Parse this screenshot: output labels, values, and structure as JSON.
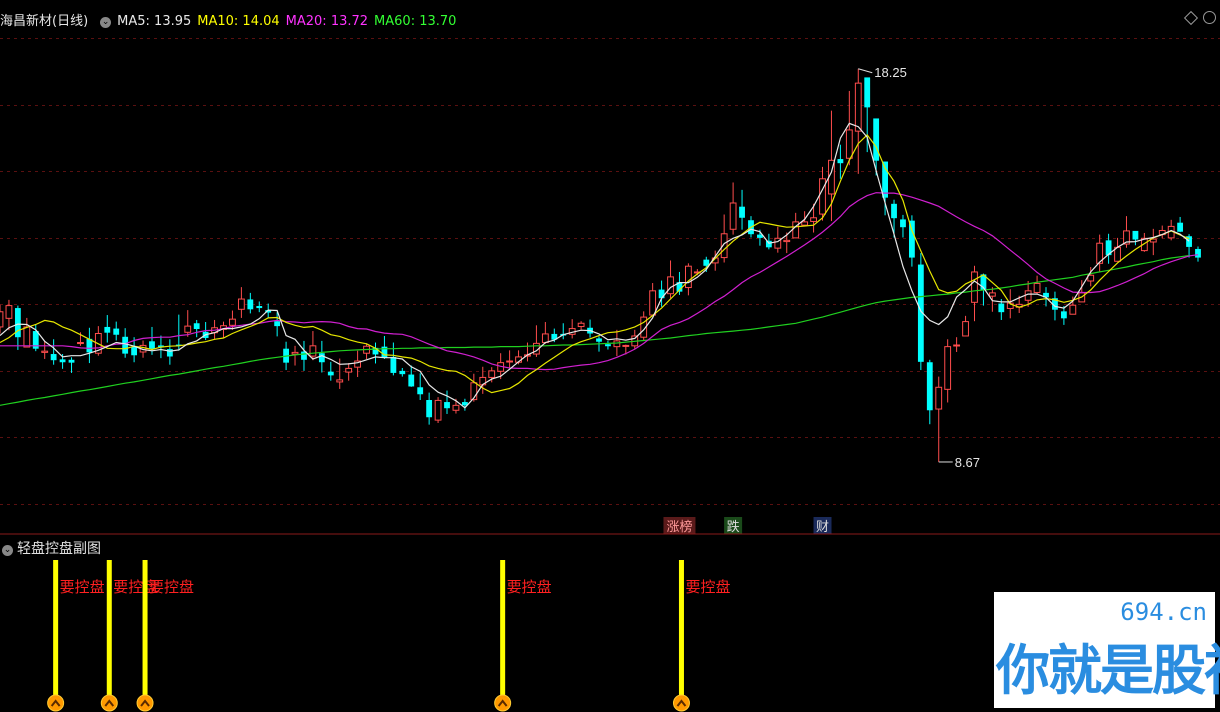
{
  "header": {
    "stock_title": "海昌新材(日线)",
    "ma_labels": [
      {
        "text": "MA5: 13.95",
        "color": "#e8e8e8"
      },
      {
        "text": "MA10: 14.04",
        "color": "#ffff00"
      },
      {
        "text": "MA20: 13.72",
        "color": "#ff33ff"
      },
      {
        "text": "MA60: 13.70",
        "color": "#33ff33"
      }
    ]
  },
  "colors": {
    "up": "#ff4d4d",
    "down": "#00ffff",
    "ma5": "#e8e8e8",
    "ma10": "#e6e600",
    "ma20": "#d020d0",
    "ma60": "#20d020",
    "grid": "#5a1010",
    "signal": "#ffff00"
  },
  "chart_data": {
    "type": "candlestick",
    "ylim": [
      7.5,
      19.0
    ],
    "high_annotation": "18.25",
    "low_annotation": "8.67",
    "high_value": 18.25,
    "low_value": 8.67,
    "candles": [
      [
        11.96,
        12.33,
        12.5,
        11.8
      ],
      [
        12.17,
        12.48,
        12.62,
        11.88
      ],
      [
        12.42,
        11.71,
        12.48,
        11.4
      ],
      [
        11.47,
        11.96,
        12.18,
        11.46
      ],
      [
        11.86,
        11.43,
        12.03,
        11.37
      ],
      [
        11.34,
        11.37,
        11.61,
        11.18
      ],
      [
        11.3,
        11.15,
        11.66,
        11.04
      ],
      [
        11.17,
        11.1,
        11.3,
        10.94
      ],
      [
        11.16,
        11.09,
        11.22,
        10.84
      ],
      [
        11.57,
        11.58,
        11.83,
        11.5
      ],
      [
        11.67,
        11.34,
        11.94,
        11.08
      ],
      [
        11.32,
        11.8,
        11.98,
        11.26
      ],
      [
        11.96,
        11.82,
        12.25,
        11.58
      ],
      [
        11.92,
        11.77,
        12.09,
        11.63
      ],
      [
        11.72,
        11.31,
        11.93,
        11.21
      ],
      [
        11.48,
        11.27,
        11.71,
        11.1
      ],
      [
        11.35,
        11.51,
        11.63,
        11.21
      ],
      [
        11.61,
        11.43,
        11.96,
        11.28
      ],
      [
        11.51,
        11.47,
        11.75,
        11.2
      ],
      [
        11.42,
        11.24,
        11.66,
        11.04
      ],
      [
        11.53,
        11.5,
        12.26,
        11.38
      ],
      [
        11.83,
        11.98,
        12.37,
        11.72
      ],
      [
        12.05,
        11.91,
        12.13,
        11.71
      ],
      [
        11.84,
        11.69,
        12.08,
        11.64
      ],
      [
        11.82,
        11.94,
        12.13,
        11.66
      ],
      [
        11.9,
        11.99,
        12.09,
        11.7
      ],
      [
        12.0,
        12.15,
        12.36,
        11.89
      ],
      [
        12.39,
        12.64,
        12.93,
        12.18
      ],
      [
        12.63,
        12.39,
        12.79,
        12.29
      ],
      [
        12.47,
        12.42,
        12.58,
        12.32
      ],
      [
        12.37,
        12.31,
        12.53,
        12.18
      ],
      [
        12.1,
        11.98,
        12.32,
        11.73
      ],
      [
        11.43,
        11.09,
        11.6,
        10.91
      ],
      [
        11.3,
        11.34,
        11.5,
        11.02
      ],
      [
        11.36,
        11.16,
        11.62,
        10.89
      ],
      [
        11.25,
        11.5,
        11.86,
        11.15
      ],
      [
        11.32,
        11.1,
        11.62,
        10.85
      ],
      [
        10.87,
        10.78,
        11.11,
        10.65
      ],
      [
        10.62,
        10.67,
        11.19,
        10.45
      ],
      [
        10.86,
        10.95,
        11.08,
        10.65
      ],
      [
        10.98,
        11.13,
        11.38,
        10.74
      ],
      [
        11.32,
        11.49,
        11.56,
        11.18
      ],
      [
        11.45,
        11.29,
        11.58,
        11.07
      ],
      [
        11.48,
        11.21,
        11.74,
        11.18
      ],
      [
        11.23,
        10.84,
        11.58,
        10.78
      ],
      [
        10.89,
        10.81,
        10.96,
        10.75
      ],
      [
        10.8,
        10.51,
        11.02,
        10.5
      ],
      [
        10.49,
        10.32,
        10.83,
        10.18
      ],
      [
        10.18,
        9.76,
        10.36,
        9.58
      ],
      [
        9.69,
        10.17,
        10.25,
        9.62
      ],
      [
        10.13,
        9.98,
        10.41,
        9.84
      ],
      [
        9.93,
        10.05,
        10.21,
        9.85
      ],
      [
        10.13,
        10.05,
        10.21,
        9.92
      ],
      [
        10.19,
        10.6,
        10.82,
        10.14
      ],
      [
        10.55,
        10.73,
        10.99,
        10.33
      ],
      [
        10.73,
        10.89,
        10.98,
        10.61
      ],
      [
        10.88,
        11.09,
        11.32,
        10.69
      ],
      [
        11.11,
        11.13,
        11.39,
        10.95
      ],
      [
        11.1,
        11.23,
        11.39,
        11.05
      ],
      [
        11.25,
        11.28,
        11.58,
        11.12
      ],
      [
        11.3,
        11.56,
        12.0,
        11.23
      ],
      [
        11.58,
        11.79,
        12.08,
        11.55
      ],
      [
        11.79,
        11.65,
        11.92,
        11.59
      ],
      [
        11.79,
        11.75,
        12.05,
        11.66
      ],
      [
        11.78,
        11.92,
        12.15,
        11.68
      ],
      [
        11.97,
        12.05,
        12.1,
        11.9
      ],
      [
        11.94,
        11.8,
        12.14,
        11.7
      ],
      [
        11.68,
        11.6,
        11.73,
        11.36
      ],
      [
        11.54,
        11.49,
        11.62,
        11.41
      ],
      [
        11.48,
        11.62,
        11.89,
        11.25
      ],
      [
        11.51,
        11.51,
        11.53,
        11.29
      ],
      [
        11.5,
        11.74,
        11.89,
        11.42
      ],
      [
        11.71,
        12.2,
        12.34,
        11.63
      ],
      [
        12.25,
        12.84,
        13.03,
        12.22
      ],
      [
        12.87,
        12.66,
        13.09,
        12.45
      ],
      [
        12.77,
        13.18,
        13.58,
        12.66
      ],
      [
        13.05,
        12.82,
        13.3,
        12.74
      ],
      [
        12.92,
        13.44,
        13.51,
        12.73
      ],
      [
        13.28,
        13.3,
        13.37,
        13.22
      ],
      [
        13.6,
        13.45,
        13.67,
        13.3
      ],
      [
        13.52,
        13.64,
        13.82,
        13.33
      ],
      [
        13.65,
        14.23,
        14.7,
        13.53
      ],
      [
        14.34,
        14.98,
        15.48,
        14.21
      ],
      [
        14.89,
        14.62,
        15.3,
        14.33
      ],
      [
        14.56,
        14.22,
        14.66,
        14.14
      ],
      [
        14.21,
        14.13,
        14.33,
        13.94
      ],
      [
        14.06,
        13.9,
        14.23,
        13.85
      ],
      [
        13.88,
        14.12,
        14.4,
        13.77
      ],
      [
        14.04,
        14.07,
        14.26,
        13.76
      ],
      [
        14.13,
        14.52,
        14.74,
        14.14
      ],
      [
        14.44,
        14.52,
        14.78,
        14.45
      ],
      [
        14.53,
        14.62,
        14.96,
        14.26
      ],
      [
        14.71,
        15.57,
        15.86,
        14.55
      ],
      [
        15.2,
        16.02,
        17.23,
        14.54
      ],
      [
        16.05,
        15.95,
        16.4,
        15.57
      ],
      [
        16.07,
        16.76,
        17.71,
        15.9
      ],
      [
        16.73,
        17.9,
        18.25,
        15.69
      ],
      [
        18.04,
        17.31,
        17.64,
        16.22
      ],
      [
        17.04,
        16.01,
        16.94,
        15.65
      ],
      [
        15.99,
        15.11,
        15.36,
        14.68
      ],
      [
        14.96,
        14.61,
        15.06,
        14.14
      ],
      [
        14.58,
        14.39,
        14.69,
        14.14
      ],
      [
        14.55,
        13.65,
        14.68,
        13.43
      ],
      [
        13.48,
        11.11,
        13.76,
        10.91
      ],
      [
        11.1,
        9.93,
        11.16,
        9.59
      ],
      [
        9.96,
        10.49,
        10.75,
        8.67
      ],
      [
        10.44,
        11.48,
        11.66,
        10.12
      ],
      [
        11.51,
        11.52,
        11.71,
        11.35
      ],
      [
        11.74,
        12.09,
        12.23,
        11.86
      ],
      [
        12.56,
        13.3,
        13.45,
        12.1
      ],
      [
        13.24,
        12.85,
        13.26,
        12.48
      ],
      [
        12.71,
        12.79,
        12.93,
        12.33
      ],
      [
        12.53,
        12.32,
        12.64,
        12.13
      ],
      [
        12.41,
        12.54,
        12.88,
        12.17
      ],
      [
        12.44,
        12.51,
        12.72,
        12.3
      ],
      [
        12.61,
        12.84,
        13.08,
        12.45
      ],
      [
        12.8,
        13.02,
        13.21,
        12.76
      ],
      [
        12.79,
        12.68,
        12.93,
        12.46
      ],
      [
        12.66,
        12.38,
        12.82,
        12.12
      ],
      [
        12.34,
        12.17,
        12.47,
        12.01
      ],
      [
        12.27,
        12.49,
        12.7,
        12.28
      ],
      [
        12.57,
        12.79,
        13.1,
        12.58
      ],
      [
        13.08,
        13.22,
        13.42,
        12.95
      ],
      [
        13.51,
        14.0,
        14.21,
        13.31
      ],
      [
        14.07,
        13.71,
        14.23,
        13.5
      ],
      [
        13.56,
        13.9,
        14.13,
        13.55
      ],
      [
        13.98,
        14.3,
        14.66,
        13.89
      ],
      [
        14.3,
        14.09,
        14.29,
        13.95
      ],
      [
        13.82,
        14.12,
        14.25,
        13.79
      ],
      [
        14.03,
        14.1,
        14.35,
        13.71
      ],
      [
        14.21,
        14.31,
        14.43,
        14.12
      ],
      [
        14.13,
        14.41,
        14.57,
        14.07
      ],
      [
        14.5,
        14.28,
        14.64,
        14.27
      ],
      [
        14.17,
        13.91,
        14.22,
        13.65
      ],
      [
        13.86,
        13.65,
        13.92,
        13.55
      ]
    ],
    "ma5": [
      11.75,
      11.94,
      12.03,
      12.02,
      11.89,
      11.61,
      11.45,
      11.23,
      11.26,
      11.26,
      11.32,
      11.39,
      11.48,
      11.58,
      11.55,
      11.49,
      11.41,
      11.38,
      11.41,
      11.37,
      11.4,
      11.55,
      11.62,
      11.77,
      11.82,
      11.92,
      11.92,
      11.96,
      12.03,
      12.16,
      12.37,
      12.36,
      11.75,
      11.66,
      11.39,
      11.18,
      11.26,
      11.17,
      11.05,
      11.06,
      11.09,
      11.16,
      11.23,
      11.21,
      11.21,
      11.18,
      10.99,
      10.88,
      10.55,
      10.37,
      10.28,
      10.16,
      9.99,
      10.23,
      10.56,
      10.69,
      10.76,
      10.93,
      11.11,
      11.28,
      11.38,
      11.58,
      11.64,
      11.77,
      11.83,
      11.88,
      11.87,
      11.79,
      11.65,
      11.67,
      11.64,
      11.68,
      11.89,
      12.18,
      12.66,
      12.92,
      13.04,
      13.04,
      13.17,
      13.36,
      13.68,
      13.99,
      14.12,
      14.2,
      14.34,
      14.28,
      14.0,
      14.04,
      14.2,
      14.41,
      14.58,
      14.9,
      15.31,
      15.73,
      16.56,
      16.92,
      16.84,
      16.58,
      15.77,
      14.98,
      14.22,
      13.43,
      12.84,
      12.34,
      12.12,
      12.02,
      12.21,
      12.69,
      12.87,
      13.08,
      12.92,
      12.6,
      12.57,
      12.57,
      12.67,
      12.76,
      12.76,
      12.68,
      12.46,
      12.42,
      12.59,
      12.94,
      13.3,
      13.54,
      13.73,
      13.9,
      14.03,
      14.04,
      14.1,
      14.14,
      14.21,
      14.31,
      14.22,
      14.05
    ],
    "ma10": [
      11.58,
      11.7,
      11.87,
      11.95,
      12.02,
      12.12,
      12.08,
      11.96,
      11.88,
      11.77,
      11.66,
      11.55,
      11.44,
      11.43,
      11.43,
      11.49,
      11.46,
      11.41,
      11.47,
      11.49,
      11.5,
      11.53,
      11.57,
      11.6,
      11.66,
      11.69,
      11.8,
      11.89,
      11.97,
      12.06,
      12.18,
      12.19,
      12.07,
      12.0,
      11.95,
      11.97,
      11.88,
      11.77,
      11.73,
      11.65,
      11.59,
      11.55,
      11.44,
      11.28,
      11.27,
      11.23,
      11.2,
      11.12,
      11.01,
      10.95,
      10.9,
      10.88,
      10.78,
      10.62,
      10.47,
      10.36,
      10.41,
      10.46,
      10.59,
      10.78,
      10.92,
      11.08,
      11.22,
      11.37,
      11.51,
      11.6,
      11.67,
      11.75,
      11.82,
      11.84,
      11.89,
      11.96,
      12.07,
      12.24,
      12.42,
      12.64,
      12.86,
      13.08,
      13.25,
      13.4,
      13.63,
      13.85,
      14.05,
      14.22,
      14.39,
      14.51,
      14.47,
      14.43,
      14.39,
      14.4,
      14.42,
      14.44,
      14.62,
      14.96,
      15.51,
      16.02,
      16.43,
      16.64,
      16.35,
      15.83,
      15.51,
      15.04,
      14.31,
      13.81,
      13.32,
      12.87,
      12.79,
      12.83,
      13.01,
      13.11,
      13.23,
      13.04,
      12.85,
      12.52,
      12.44,
      12.51,
      12.62,
      12.65,
      12.62,
      12.56,
      12.61,
      12.69,
      12.86,
      13.1,
      13.31,
      13.52,
      13.69,
      13.85,
      13.99,
      14.13,
      14.21,
      14.3,
      14.2,
      14.11
    ],
    "ma20": [
      11.5,
      11.5,
      11.5,
      11.5,
      11.5,
      11.5,
      11.5,
      11.5,
      11.48,
      11.45,
      11.44,
      11.45,
      11.5,
      11.54,
      11.55,
      11.63,
      11.68,
      11.7,
      11.71,
      11.71,
      11.75,
      11.77,
      11.83,
      11.87,
      11.88,
      11.92,
      11.97,
      12.0,
      12.03,
      12.05,
      12.09,
      12.12,
      12.09,
      12.08,
      12.06,
      12.08,
      12.09,
      12.08,
      12.05,
      11.97,
      11.92,
      11.91,
      11.85,
      11.81,
      11.79,
      11.78,
      11.72,
      11.63,
      11.54,
      11.46,
      11.38,
      11.34,
      11.29,
      11.23,
      11.15,
      11.06,
      11.0,
      10.96,
      10.95,
      10.95,
      10.93,
      10.92,
      10.93,
      10.97,
      11.0,
      11.03,
      11.05,
      11.09,
      11.14,
      11.22,
      11.31,
      11.42,
      11.56,
      11.73,
      11.9,
      12.0,
      12.07,
      12.16,
      12.29,
      12.43,
      12.58,
      12.71,
      12.87,
      13.04,
      13.18,
      13.29,
      13.42,
      13.55,
      13.68,
      13.82,
      13.96,
      14.11,
      14.27,
      14.45,
      14.65,
      14.89,
      15.04,
      15.16,
      15.23,
      15.22,
      15.22,
      15.18,
      15.12,
      15.05,
      14.98,
      14.9,
      14.77,
      14.64,
      14.52,
      14.41,
      14.31,
      14.18,
      14.01,
      13.83,
      13.66,
      13.48,
      13.29,
      13.13,
      13.02,
      12.91,
      12.81,
      12.8,
      12.8,
      12.82,
      12.89,
      12.97,
      13.06,
      13.16,
      13.26,
      13.38,
      13.47,
      13.55,
      13.62,
      13.69,
      13.72
    ],
    "ma60": [
      10.05,
      10.09,
      10.13,
      10.17,
      10.21,
      10.24,
      10.28,
      10.32,
      10.36,
      10.4,
      10.43,
      10.47,
      10.51,
      10.55,
      10.59,
      10.62,
      10.66,
      10.7,
      10.74,
      10.78,
      10.81,
      10.85,
      10.89,
      10.93,
      10.97,
      11.0,
      11.04,
      11.08,
      11.12,
      11.16,
      11.19,
      11.22,
      11.25,
      11.28,
      11.3,
      11.32,
      11.34,
      11.36,
      11.38,
      11.39,
      11.4,
      11.41,
      11.42,
      11.43,
      11.43,
      11.44,
      11.44,
      11.45,
      11.45,
      11.45,
      11.46,
      11.46,
      11.46,
      11.47,
      11.47,
      11.47,
      11.48,
      11.48,
      11.48,
      11.49,
      11.5,
      11.5,
      11.51,
      11.52,
      11.52,
      11.53,
      11.54,
      11.55,
      11.56,
      11.57,
      11.59,
      11.61,
      11.63,
      11.65,
      11.67,
      11.69,
      11.72,
      11.75,
      11.77,
      11.8,
      11.82,
      11.84,
      11.86,
      11.88,
      11.9,
      11.93,
      11.96,
      11.99,
      12.02,
      12.05,
      12.1,
      12.15,
      12.2,
      12.26,
      12.32,
      12.38,
      12.44,
      12.5,
      12.55,
      12.59,
      12.62,
      12.65,
      12.68,
      12.7,
      12.72,
      12.74,
      12.76,
      12.79,
      12.81,
      12.84,
      12.86,
      12.88,
      12.91,
      12.94,
      12.98,
      13.01,
      13.05,
      13.08,
      13.11,
      13.14,
      13.17,
      13.22,
      13.26,
      13.3,
      13.34,
      13.38,
      13.42,
      13.47,
      13.51,
      13.55,
      13.6,
      13.64,
      13.67,
      13.7
    ]
  },
  "subchart": {
    "title": "轻盘控盘副图",
    "signal_label": "要控盘",
    "signal_indices": [
      6,
      12,
      16,
      56,
      76
    ]
  },
  "event_tags": [
    {
      "text": "涨榜",
      "index": 76,
      "bg": "#5a1a1a",
      "fg": "#ff9999"
    },
    {
      "text": "跌",
      "index": 82,
      "bg": "#1a4a1a",
      "fg": "#dddddd"
    },
    {
      "text": "财",
      "index": 92,
      "bg": "#1a2a5a",
      "fg": "#dddddd"
    }
  ],
  "watermark": {
    "url": "694.cn",
    "text": "你就是股神"
  }
}
